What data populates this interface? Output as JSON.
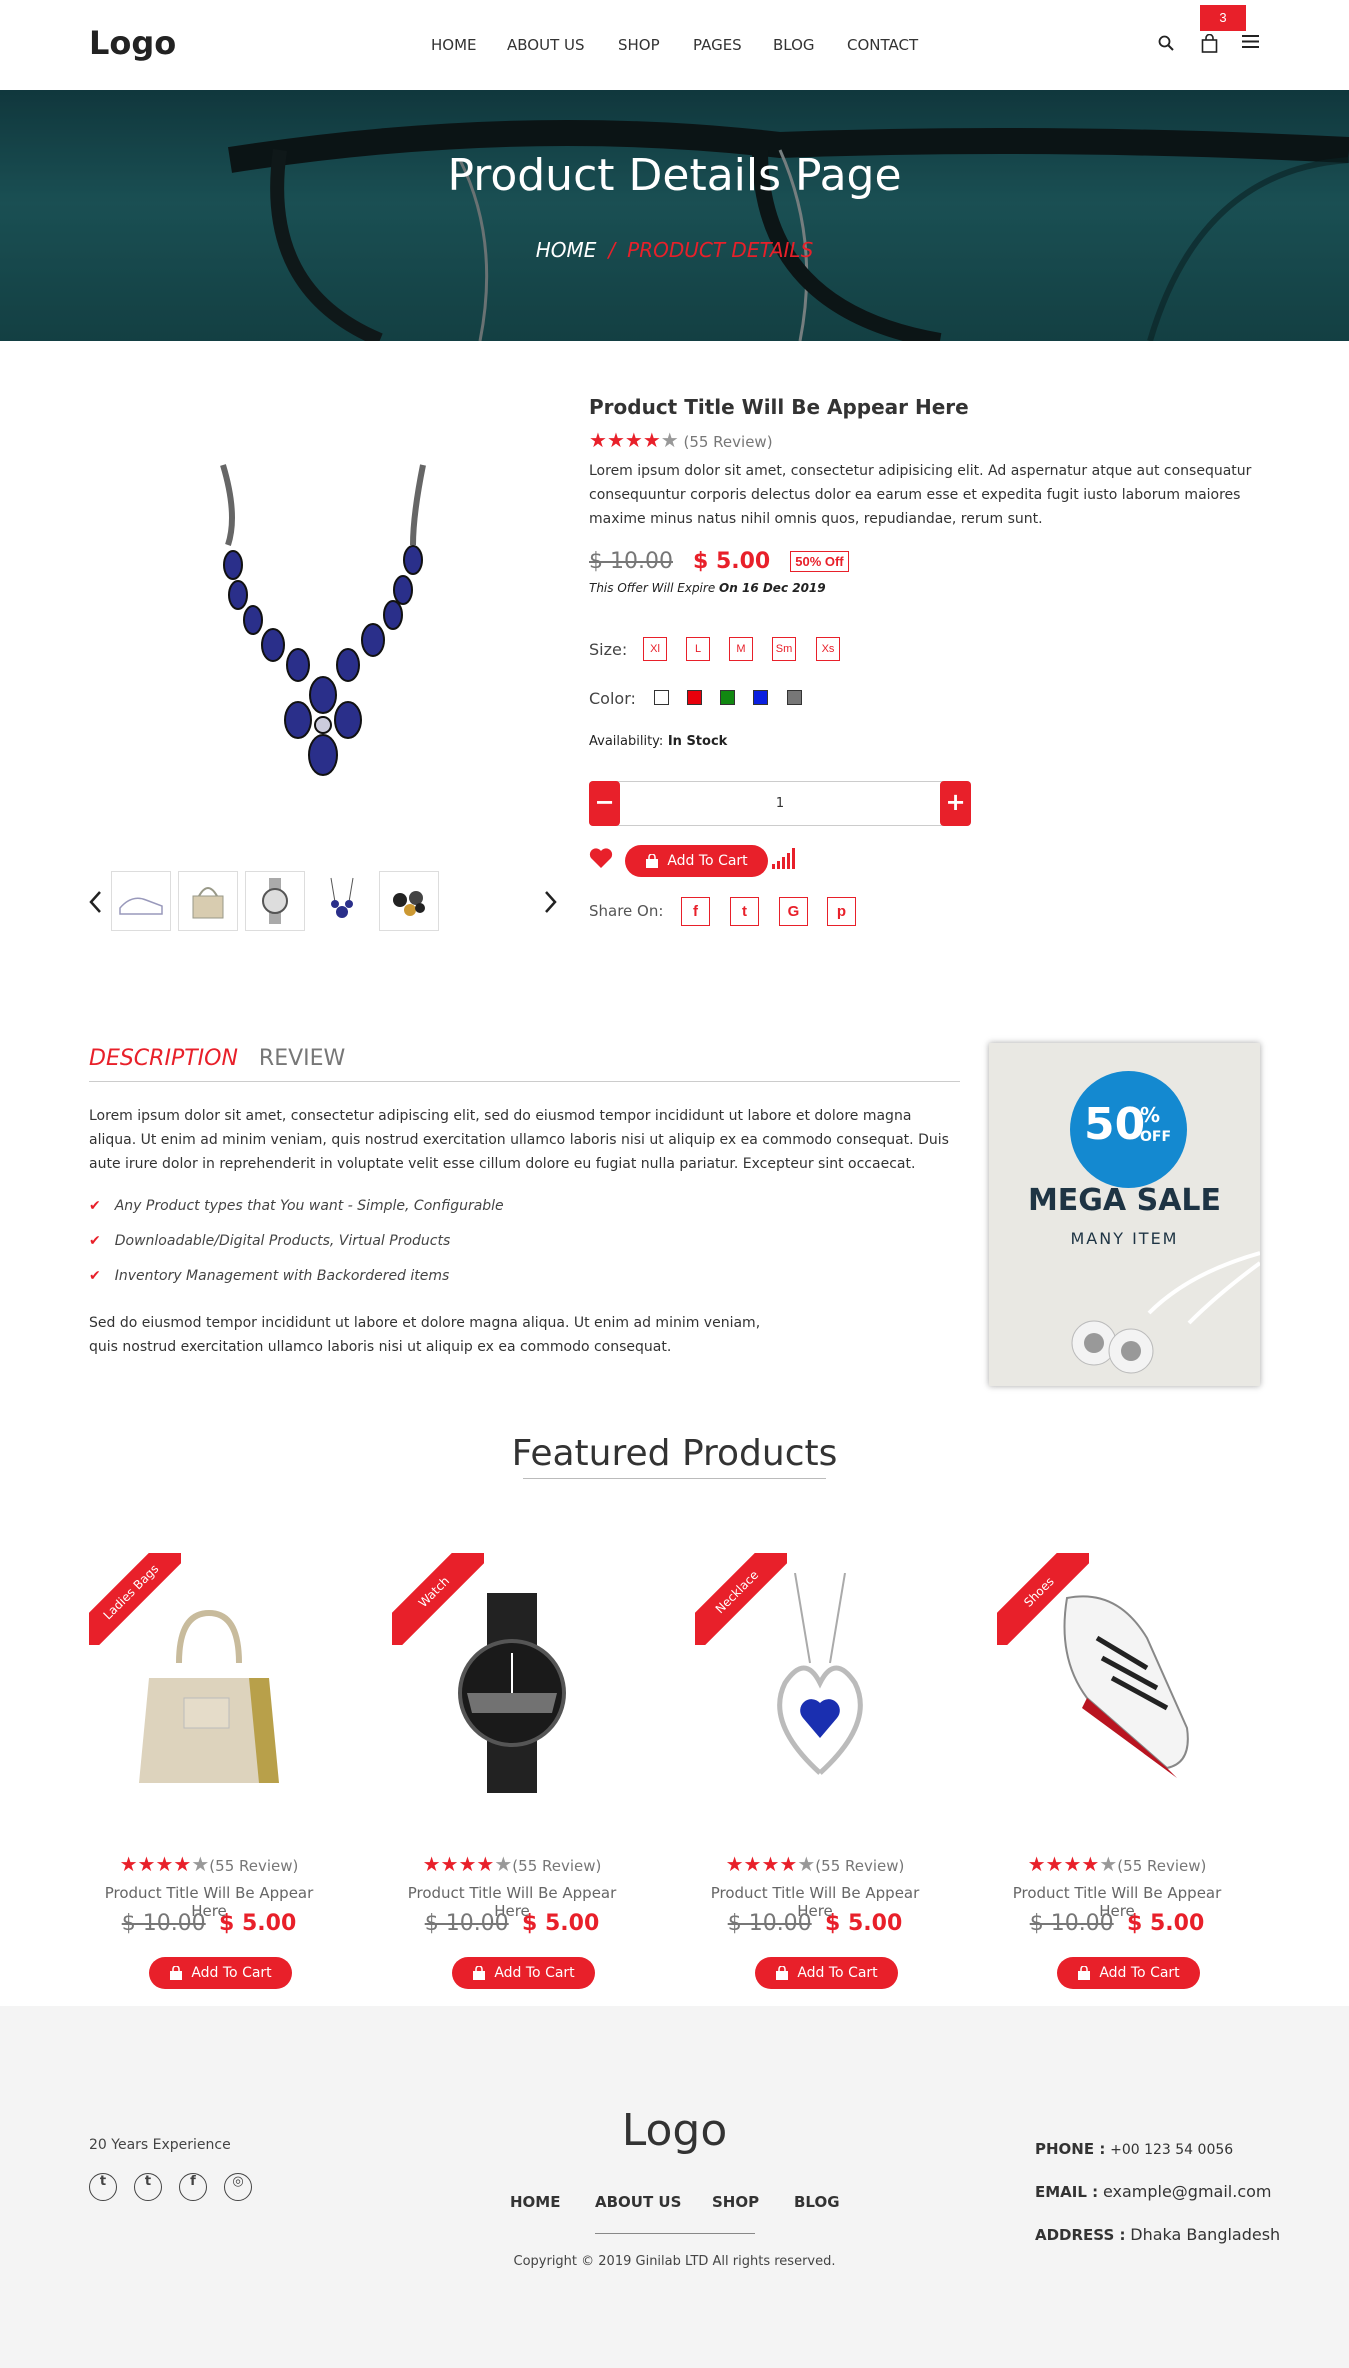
{
  "header": {
    "logo": "Logo",
    "nav": [
      "HOME",
      "ABOUT US",
      "SHOP",
      "PAGES",
      "BLOG",
      "CONTACT"
    ],
    "cart_count": "3"
  },
  "hero": {
    "title": "Product Details Page",
    "breadcrumb_home": "HOME",
    "breadcrumb_sep": "/",
    "breadcrumb_current": "PRODUCT DETAILS"
  },
  "product": {
    "title": "Product Title Will Be Appear Here",
    "rating": 4,
    "max_rating": 5,
    "reviews": "(55 Review)",
    "description": "Lorem ipsum dolor sit amet, consectetur adipisicing elit. Ad aspernatur atque aut consequatur consequuntur corporis delectus dolor ea earum esse et expedita fugit iusto laborum maiores maxime minus natus nihil omnis quos, repudiandae, rerum sunt.",
    "old_price": "$ 10.00",
    "new_price": "$ 5.00",
    "discount": "50% Off",
    "offer_text": "This Offer Will Expire",
    "offer_date": "On 16 Dec 2019",
    "size_label": "Size:",
    "sizes": [
      "Xl",
      "L",
      "M",
      "Sm",
      "Xs"
    ],
    "color_label": "Color:",
    "colors": [
      "#ffffff",
      "#e8000b",
      "#118811",
      "#0a1fe0",
      "#777777"
    ],
    "availability_label": "Availability:",
    "availability": "In Stock",
    "quantity": "1",
    "minus": "−",
    "plus": "+",
    "add_to_cart": "Add To Cart",
    "share_label": "Share On:",
    "share": [
      "f",
      "t",
      "G",
      "p"
    ]
  },
  "tabs": {
    "description": "DESCRIPTION",
    "review": "REVIEW"
  },
  "description": {
    "para1": "Lorem ipsum dolor sit amet, consectetur adipiscing elit, sed do eiusmod tempor incididunt ut labore et dolore magna aliqua. Ut enim ad minim veniam, quis nostrud exercitation ullamco laboris nisi ut aliquip ex ea commodo consequat. Duis aute irure dolor in reprehenderit in voluptate velit esse cillum dolore eu fugiat nulla pariatur. Excepteur sint occaecat.",
    "features": [
      "Any Product types that You want - Simple, Configurable",
      "Downloadable/Digital Products, Virtual Products",
      "Inventory Management with Backordered items"
    ],
    "para2_line1": "Sed do eiusmod tempor incididunt ut labore et dolore magna aliqua. Ut enim ad minim veniam,",
    "para2_line2": "quis nostrud exercitation ullamco laboris nisi ut aliquip ex ea commodo consequat."
  },
  "promo": {
    "pct": "50",
    "pct_sign": "%",
    "off": "OFF",
    "headline": "MEGA SALE",
    "sub": "MANY ITEM"
  },
  "featured": {
    "title": "Featured Products",
    "items": [
      {
        "category": "Ladies Bags",
        "reviews": "(55 Review)",
        "title": "Product Title Will Be Appear Here",
        "old_price": "$ 10.00",
        "new_price": "$ 5.00",
        "button": "Add To Cart"
      },
      {
        "category": "Watch",
        "reviews": "(55 Review)",
        "title": "Product Title Will Be Appear Here",
        "old_price": "$ 10.00",
        "new_price": "$ 5.00",
        "button": "Add To Cart"
      },
      {
        "category": "Necklace",
        "reviews": "(55 Review)",
        "title": "Product Title Will Be Appear Here",
        "old_price": "$ 10.00",
        "new_price": "$ 5.00",
        "button": "Add To Cart"
      },
      {
        "category": "Shoes",
        "reviews": "(55 Review)",
        "title": "Product Title Will Be Appear Here",
        "old_price": "$ 10.00",
        "new_price": "$ 5.00",
        "button": "Add To Cart"
      }
    ]
  },
  "footer": {
    "experience": "20 Years Experience",
    "logo": "Logo",
    "nav": [
      "HOME",
      "ABOUT US",
      "SHOP",
      "BLOG"
    ],
    "copyright": "Copyright © 2019 Ginilab LTD All rights reserved.",
    "phone_label": "PHONE :",
    "phone": "+00 123 54 0056",
    "email_label": "EMAIL :",
    "email": "example@gmail.com",
    "address_label": "ADDRESS :",
    "address": "Dhaka Bangladesh"
  },
  "colors": {
    "accent": "#e8202a",
    "footer_bg": "#f4f4f4",
    "hero_bg": "#1f5a5e"
  }
}
